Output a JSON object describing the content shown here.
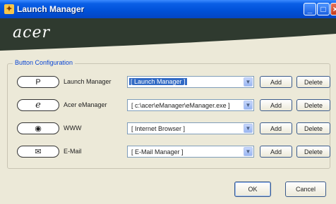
{
  "window": {
    "title": "Launch Manager"
  },
  "header": {
    "logo": "acer"
  },
  "group": {
    "title": "Button Configuration"
  },
  "rows": [
    {
      "key_glyph": "P",
      "label": "Launch Manager",
      "value": "[ Launch Manager ]",
      "selected": true
    },
    {
      "key_glyph": "e",
      "label": "Acer eManager",
      "value": "[ c:\\acer\\eManager\\eManager.exe ]",
      "selected": false
    },
    {
      "key_glyph": "◉",
      "label": "WWW",
      "value": "[ Internet Browser ]",
      "selected": false
    },
    {
      "key_glyph": "✉",
      "label": "E-Mail",
      "value": "[ E-Mail Manager ]",
      "selected": false
    }
  ],
  "buttons": {
    "add": "Add",
    "delete": "Delete",
    "ok": "OK",
    "cancel": "Cancel"
  },
  "colors": {
    "titlebar": "#0050d8",
    "header": "#2f3a2f",
    "selection": "#316ac5"
  }
}
